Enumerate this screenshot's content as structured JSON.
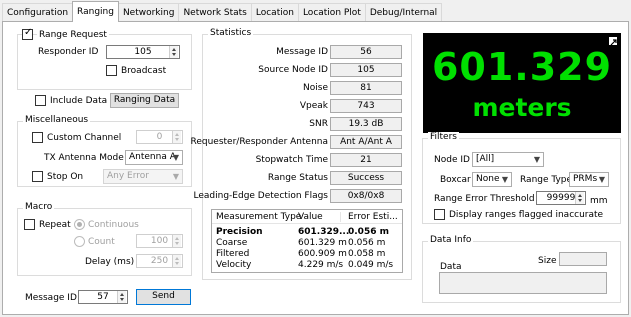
{
  "tabs": [
    "Configuration",
    "Ranging",
    "Networking",
    "Network Stats",
    "Location",
    "Location Plot",
    "Debug/Internal"
  ],
  "active_tab": 1,
  "range_request": {
    "title": "Range Request",
    "checked": true,
    "responder_id_label": "Responder ID",
    "responder_id_value": "105",
    "broadcast_label": "Broadcast"
  },
  "include_data": {
    "label": "Include Data",
    "button": "Ranging Data"
  },
  "misc": {
    "title": "Miscellaneous",
    "custom_channel_label": "Custom Channel",
    "custom_channel_value": "0",
    "tx_antenna_label": "TX Antenna Mode",
    "tx_antenna_value": "Antenna A",
    "stop_on_label": "Stop On",
    "stop_on_value": "Any Error"
  },
  "macro": {
    "title": "Macro",
    "repeat_label": "Repeat",
    "continuous_label": "Continuous",
    "count_label": "Count",
    "count_value": "100",
    "delay_label": "Delay (ms)",
    "delay_value": "250"
  },
  "message": {
    "label": "Message ID",
    "value": "57",
    "send": "Send"
  },
  "statistics": {
    "title": "Statistics",
    "rows": [
      {
        "label": "Message ID",
        "value": "56"
      },
      {
        "label": "Source Node ID",
        "value": "105"
      },
      {
        "label": "Noise",
        "value": "81"
      },
      {
        "label": "Vpeak",
        "value": "743"
      },
      {
        "label": "SNR",
        "value": "19.3 dB"
      },
      {
        "label": "Requester/Responder Antenna",
        "value": "Ant A/Ant A"
      },
      {
        "label": "Stopwatch Time",
        "value": "21"
      },
      {
        "label": "Range Status",
        "value": "Success"
      },
      {
        "label": "Leading-Edge Detection Flags",
        "value": "0x8/0x8"
      }
    ],
    "table_headers": [
      "Measurement Type",
      "Value",
      "Error Esti..."
    ],
    "table_rows": [
      [
        "Precision",
        "601.329...",
        "0.056 m"
      ],
      [
        "Coarse",
        "601.329 m",
        "0.056 m"
      ],
      [
        "Filtered",
        "600.909 m",
        "0.058 m"
      ],
      [
        "Velocity",
        "4.229 m/s",
        "0.049 m/s"
      ]
    ]
  },
  "display": {
    "value": "601.329",
    "unit": "meters",
    "color": "#00e000"
  },
  "filters": {
    "title": "Filters",
    "node_id_label": "Node ID",
    "node_id_value": "[All]",
    "boxcar_label": "Boxcar",
    "boxcar_value": "None",
    "range_type_label": "Range Type",
    "range_type_value": "PRMs",
    "range_err_label": "Range Error Threshold",
    "range_err_value": "99999",
    "range_err_unit": "mm",
    "flagged_label": "Display ranges flagged inaccurate"
  },
  "data_info": {
    "title": "Data Info",
    "data_label": "Data",
    "size_label": "Size"
  }
}
